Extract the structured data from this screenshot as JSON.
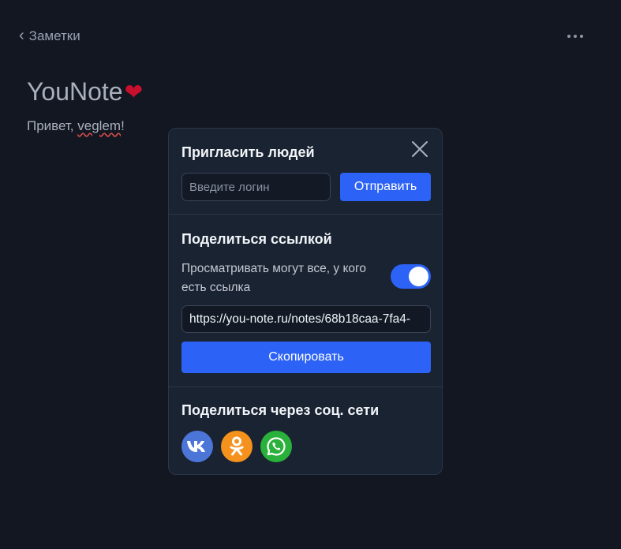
{
  "nav": {
    "back_label": "Заметки"
  },
  "note": {
    "title": "YouNote",
    "heart": "❤",
    "greeting_prefix": "Привет, ",
    "username": "veglem",
    "greeting_suffix": "!"
  },
  "modal": {
    "invite": {
      "heading": "Пригласить людей",
      "login_placeholder": "Введите логин",
      "login_value": "",
      "send_label": "Отправить"
    },
    "share_link": {
      "heading": "Поделиться ссылкой",
      "permission_text": "Просматривать могут все, у кого есть ссылка",
      "toggle_on": true,
      "url": "https://you-note.ru/notes/68b18caa-7fa4-",
      "copy_label": "Скопировать"
    },
    "social": {
      "heading": "Поделиться через соц. сети",
      "networks": [
        {
          "name": "vk-icon",
          "color": "#4c75d8"
        },
        {
          "name": "odnoklassniki-icon",
          "color": "#f5921e"
        },
        {
          "name": "whatsapp-icon",
          "color": "#2ab13b"
        }
      ]
    }
  },
  "colors": {
    "accent": "#2c62f6",
    "background": "#121722",
    "panel": "#1a2332"
  }
}
